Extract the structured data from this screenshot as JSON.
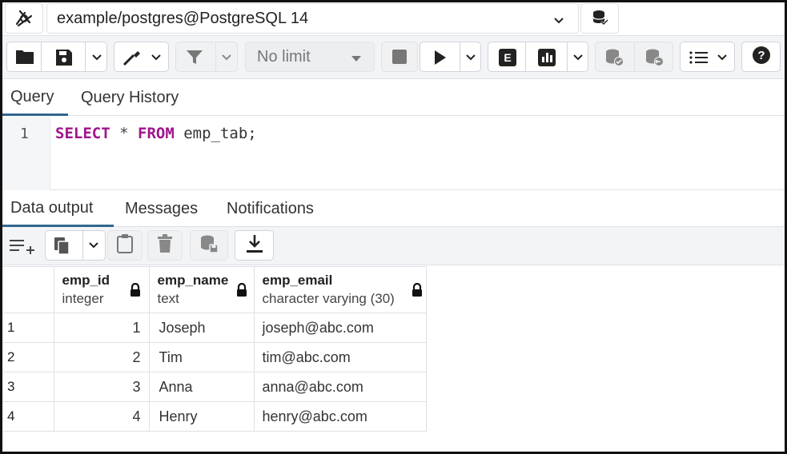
{
  "connection": {
    "label": "example/postgres@PostgreSQL 14",
    "logo_icon": "query-tool-logo-icon",
    "db_icon": "database-icon"
  },
  "toolbar": {
    "row_limit": "No limit",
    "icons": [
      "folder-icon",
      "save-icon",
      "chevron-down-icon",
      "edit-icon",
      "filter-icon",
      "stop-icon",
      "execute-icon",
      "explain-icon",
      "explain-analyze-icon",
      "commit-icon",
      "rollback-icon",
      "macros-icon",
      "help-icon"
    ]
  },
  "query_tabs": [
    {
      "label": "Query",
      "active": true
    },
    {
      "label": "Query History",
      "active": false
    }
  ],
  "editor": {
    "line_number": "1",
    "kw_select": "SELECT",
    "star": "*",
    "kw_from": "FROM",
    "table": "emp_tab;"
  },
  "result_tabs": [
    {
      "label": "Data output",
      "active": true
    },
    {
      "label": "Messages",
      "active": false
    },
    {
      "label": "Notifications",
      "active": false
    }
  ],
  "grid": {
    "columns": [
      {
        "name": "emp_id",
        "type": "integer"
      },
      {
        "name": "emp_name",
        "type": "text"
      },
      {
        "name": "emp_email",
        "type": "character varying (30)"
      }
    ],
    "rows": [
      {
        "n": "1",
        "emp_id": "1",
        "emp_name": "Joseph",
        "emp_email": "joseph@abc.com"
      },
      {
        "n": "2",
        "emp_id": "2",
        "emp_name": "Tim",
        "emp_email": "tim@abc.com"
      },
      {
        "n": "3",
        "emp_id": "3",
        "emp_name": "Anna",
        "emp_email": "anna@abc.com"
      },
      {
        "n": "4",
        "emp_id": "4",
        "emp_name": "Henry",
        "emp_email": "henry@abc.com"
      }
    ]
  },
  "colors": {
    "accent": "#326690",
    "keyword": "#a0148c"
  }
}
